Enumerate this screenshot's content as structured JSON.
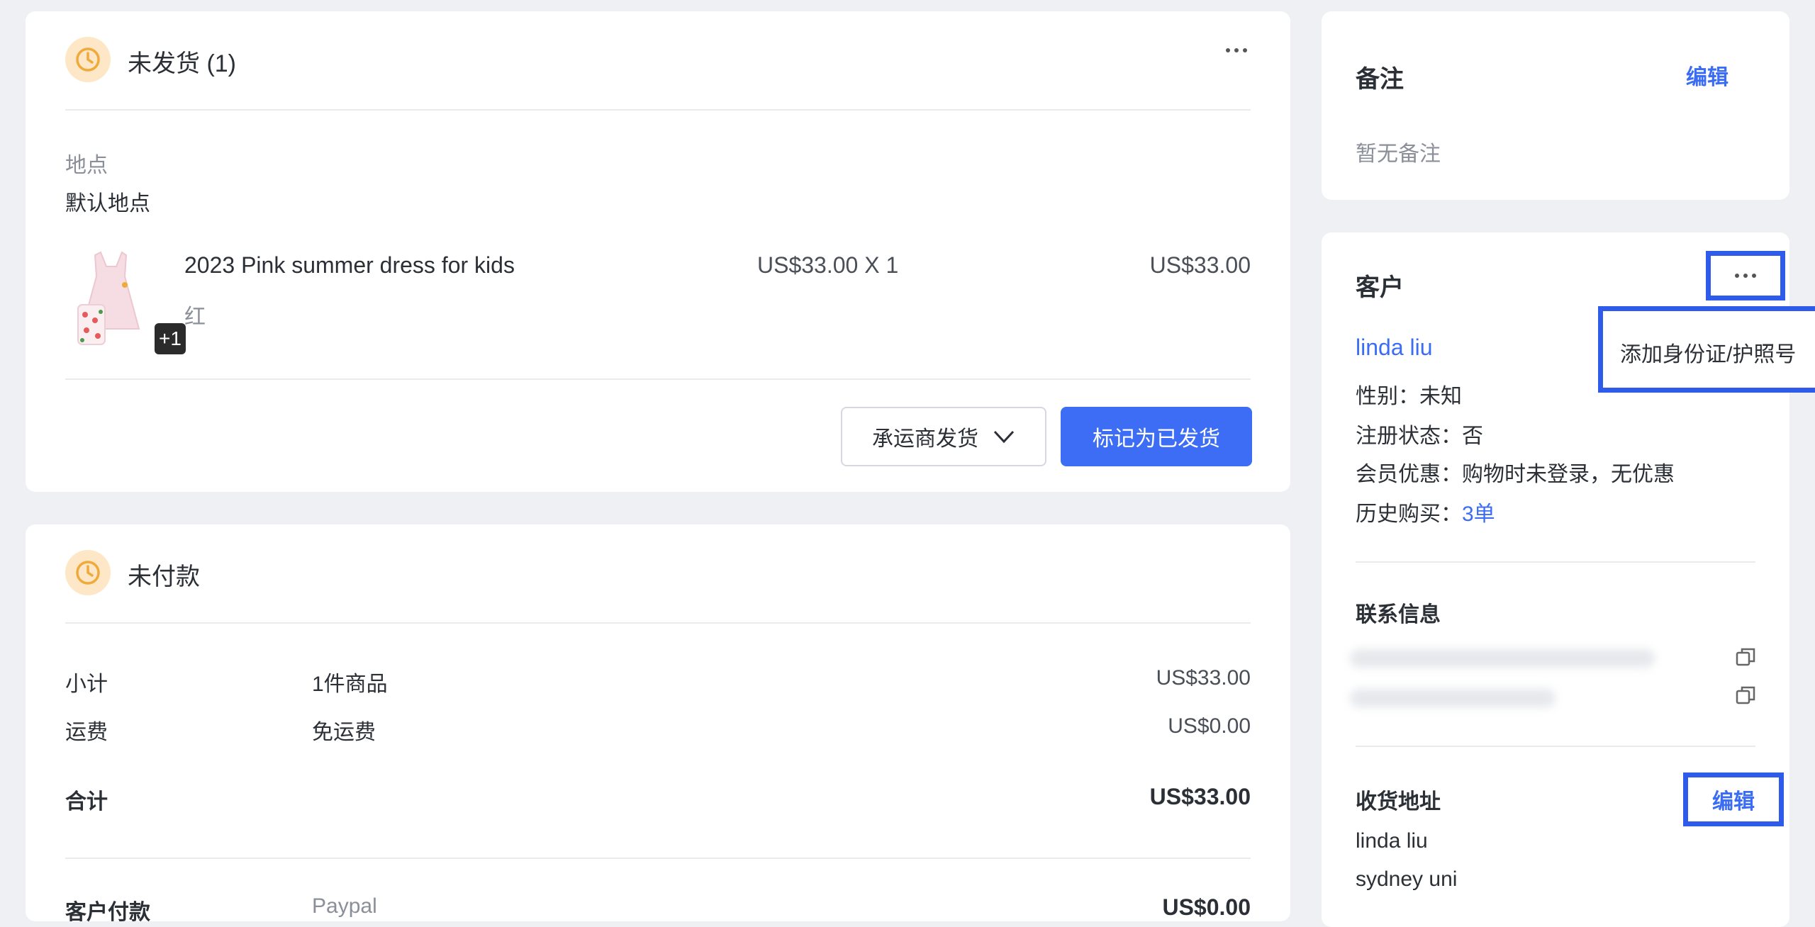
{
  "fulfillment": {
    "title": "未发货 (1)",
    "menu_icon": "ellipsis-icon",
    "location_label": "地点",
    "location_value": "默认地点",
    "item": {
      "name": "2023 Pink summer dress for kids",
      "variant": "红",
      "unit_price_qty": "US$33.00 X 1",
      "total": "US$33.00",
      "more_badge": "+1"
    },
    "carrier_button": "承运商发货",
    "mark_button": "标记为已发货"
  },
  "payment": {
    "title": "未付款",
    "rows": [
      {
        "label": "小计",
        "detail": "1件商品",
        "amount": "US$33.00"
      },
      {
        "label": "运费",
        "detail": "免运费",
        "amount": "US$0.00"
      }
    ],
    "total_label": "合计",
    "total_amount": "US$33.00",
    "paid_label": "客户付款",
    "paid_method": "Paypal",
    "paid_amount": "US$0.00"
  },
  "notes": {
    "title": "备注",
    "edit": "编辑",
    "empty": "暂无备注"
  },
  "customer": {
    "title": "客户",
    "menu_icon": "ellipsis-icon",
    "dropdown_item": "添加身份证/护照号",
    "name": "linda liu",
    "gender_label": "性别：",
    "gender_value": "未知",
    "reg_label": "注册状态：",
    "reg_value": "否",
    "member_label": "会员优惠：",
    "member_value": "购物时未登录，无优惠",
    "history_label": "历史购买：",
    "history_value": "3单",
    "contact_title": "联系信息",
    "copy_icon": "copy-icon",
    "address_title": "收货地址",
    "address_edit": "编辑",
    "address_name": "linda liu",
    "address_line1": "sydney uni"
  },
  "colors": {
    "primary": "#3a6cf4",
    "highlight": "#2f5bea",
    "pending": "#f0a93b"
  }
}
